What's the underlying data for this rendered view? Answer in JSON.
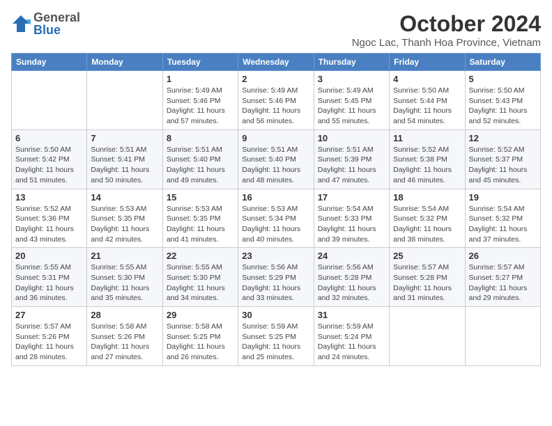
{
  "logo": {
    "general": "General",
    "blue": "Blue"
  },
  "title": "October 2024",
  "subtitle": "Ngoc Lac, Thanh Hoa Province, Vietnam",
  "weekdays": [
    "Sunday",
    "Monday",
    "Tuesday",
    "Wednesday",
    "Thursday",
    "Friday",
    "Saturday"
  ],
  "weeks": [
    [
      {
        "day": null
      },
      {
        "day": null
      },
      {
        "day": "1",
        "sunrise": "Sunrise: 5:49 AM",
        "sunset": "Sunset: 5:46 PM",
        "daylight": "Daylight: 11 hours and 57 minutes."
      },
      {
        "day": "2",
        "sunrise": "Sunrise: 5:49 AM",
        "sunset": "Sunset: 5:46 PM",
        "daylight": "Daylight: 11 hours and 56 minutes."
      },
      {
        "day": "3",
        "sunrise": "Sunrise: 5:49 AM",
        "sunset": "Sunset: 5:45 PM",
        "daylight": "Daylight: 11 hours and 55 minutes."
      },
      {
        "day": "4",
        "sunrise": "Sunrise: 5:50 AM",
        "sunset": "Sunset: 5:44 PM",
        "daylight": "Daylight: 11 hours and 54 minutes."
      },
      {
        "day": "5",
        "sunrise": "Sunrise: 5:50 AM",
        "sunset": "Sunset: 5:43 PM",
        "daylight": "Daylight: 11 hours and 52 minutes."
      }
    ],
    [
      {
        "day": "6",
        "sunrise": "Sunrise: 5:50 AM",
        "sunset": "Sunset: 5:42 PM",
        "daylight": "Daylight: 11 hours and 51 minutes."
      },
      {
        "day": "7",
        "sunrise": "Sunrise: 5:51 AM",
        "sunset": "Sunset: 5:41 PM",
        "daylight": "Daylight: 11 hours and 50 minutes."
      },
      {
        "day": "8",
        "sunrise": "Sunrise: 5:51 AM",
        "sunset": "Sunset: 5:40 PM",
        "daylight": "Daylight: 11 hours and 49 minutes."
      },
      {
        "day": "9",
        "sunrise": "Sunrise: 5:51 AM",
        "sunset": "Sunset: 5:40 PM",
        "daylight": "Daylight: 11 hours and 48 minutes."
      },
      {
        "day": "10",
        "sunrise": "Sunrise: 5:51 AM",
        "sunset": "Sunset: 5:39 PM",
        "daylight": "Daylight: 11 hours and 47 minutes."
      },
      {
        "day": "11",
        "sunrise": "Sunrise: 5:52 AM",
        "sunset": "Sunset: 5:38 PM",
        "daylight": "Daylight: 11 hours and 46 minutes."
      },
      {
        "day": "12",
        "sunrise": "Sunrise: 5:52 AM",
        "sunset": "Sunset: 5:37 PM",
        "daylight": "Daylight: 11 hours and 45 minutes."
      }
    ],
    [
      {
        "day": "13",
        "sunrise": "Sunrise: 5:52 AM",
        "sunset": "Sunset: 5:36 PM",
        "daylight": "Daylight: 11 hours and 43 minutes."
      },
      {
        "day": "14",
        "sunrise": "Sunrise: 5:53 AM",
        "sunset": "Sunset: 5:35 PM",
        "daylight": "Daylight: 11 hours and 42 minutes."
      },
      {
        "day": "15",
        "sunrise": "Sunrise: 5:53 AM",
        "sunset": "Sunset: 5:35 PM",
        "daylight": "Daylight: 11 hours and 41 minutes."
      },
      {
        "day": "16",
        "sunrise": "Sunrise: 5:53 AM",
        "sunset": "Sunset: 5:34 PM",
        "daylight": "Daylight: 11 hours and 40 minutes."
      },
      {
        "day": "17",
        "sunrise": "Sunrise: 5:54 AM",
        "sunset": "Sunset: 5:33 PM",
        "daylight": "Daylight: 11 hours and 39 minutes."
      },
      {
        "day": "18",
        "sunrise": "Sunrise: 5:54 AM",
        "sunset": "Sunset: 5:32 PM",
        "daylight": "Daylight: 11 hours and 38 minutes."
      },
      {
        "day": "19",
        "sunrise": "Sunrise: 5:54 AM",
        "sunset": "Sunset: 5:32 PM",
        "daylight": "Daylight: 11 hours and 37 minutes."
      }
    ],
    [
      {
        "day": "20",
        "sunrise": "Sunrise: 5:55 AM",
        "sunset": "Sunset: 5:31 PM",
        "daylight": "Daylight: 11 hours and 36 minutes."
      },
      {
        "day": "21",
        "sunrise": "Sunrise: 5:55 AM",
        "sunset": "Sunset: 5:30 PM",
        "daylight": "Daylight: 11 hours and 35 minutes."
      },
      {
        "day": "22",
        "sunrise": "Sunrise: 5:55 AM",
        "sunset": "Sunset: 5:30 PM",
        "daylight": "Daylight: 11 hours and 34 minutes."
      },
      {
        "day": "23",
        "sunrise": "Sunrise: 5:56 AM",
        "sunset": "Sunset: 5:29 PM",
        "daylight": "Daylight: 11 hours and 33 minutes."
      },
      {
        "day": "24",
        "sunrise": "Sunrise: 5:56 AM",
        "sunset": "Sunset: 5:28 PM",
        "daylight": "Daylight: 11 hours and 32 minutes."
      },
      {
        "day": "25",
        "sunrise": "Sunrise: 5:57 AM",
        "sunset": "Sunset: 5:28 PM",
        "daylight": "Daylight: 11 hours and 31 minutes."
      },
      {
        "day": "26",
        "sunrise": "Sunrise: 5:57 AM",
        "sunset": "Sunset: 5:27 PM",
        "daylight": "Daylight: 11 hours and 29 minutes."
      }
    ],
    [
      {
        "day": "27",
        "sunrise": "Sunrise: 5:57 AM",
        "sunset": "Sunset: 5:26 PM",
        "daylight": "Daylight: 11 hours and 28 minutes."
      },
      {
        "day": "28",
        "sunrise": "Sunrise: 5:58 AM",
        "sunset": "Sunset: 5:26 PM",
        "daylight": "Daylight: 11 hours and 27 minutes."
      },
      {
        "day": "29",
        "sunrise": "Sunrise: 5:58 AM",
        "sunset": "Sunset: 5:25 PM",
        "daylight": "Daylight: 11 hours and 26 minutes."
      },
      {
        "day": "30",
        "sunrise": "Sunrise: 5:59 AM",
        "sunset": "Sunset: 5:25 PM",
        "daylight": "Daylight: 11 hours and 25 minutes."
      },
      {
        "day": "31",
        "sunrise": "Sunrise: 5:59 AM",
        "sunset": "Sunset: 5:24 PM",
        "daylight": "Daylight: 11 hours and 24 minutes."
      },
      {
        "day": null
      },
      {
        "day": null
      }
    ]
  ]
}
